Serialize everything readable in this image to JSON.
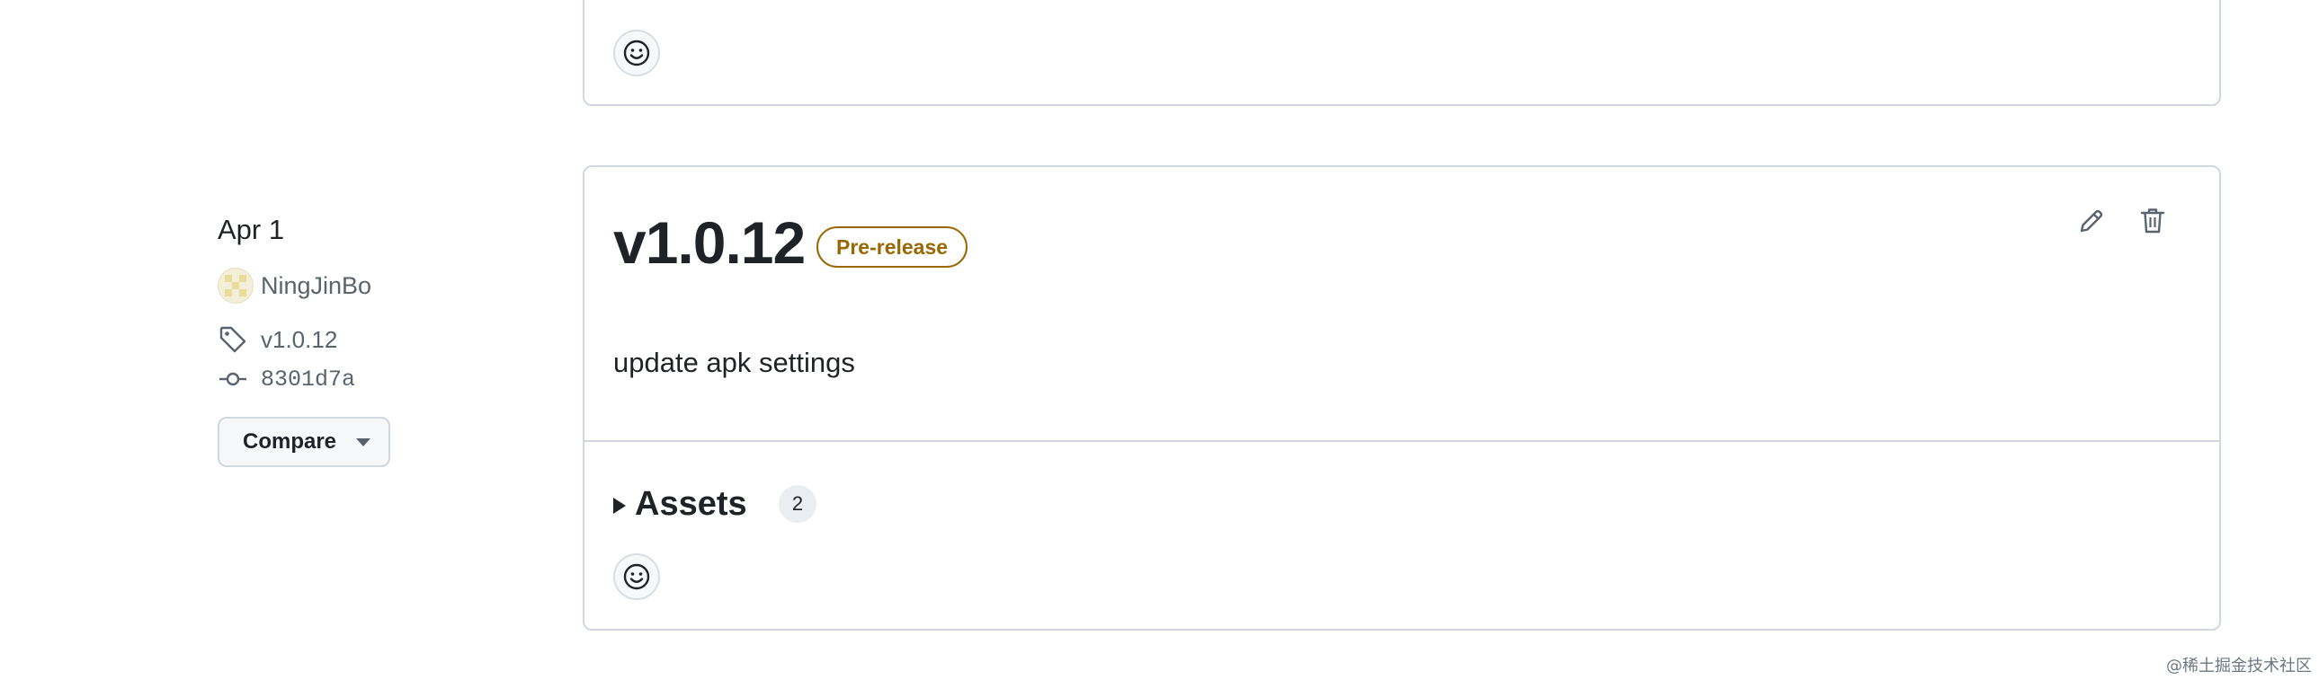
{
  "previous_release": {
    "reaction_icon": "smiley-icon"
  },
  "release": {
    "date": "Apr 1",
    "author": "NingJinBo",
    "tag": "v1.0.12",
    "commit": "8301d7a",
    "compare_label": "Compare",
    "title": "v1.0.12",
    "badge": "Pre-release",
    "note": "update apk settings",
    "assets_label": "Assets",
    "assets_count": "2",
    "icons": {
      "tag": "tag-icon",
      "commit": "git-commit-icon",
      "edit": "pencil-icon",
      "delete": "trash-icon",
      "reaction": "smiley-icon"
    }
  },
  "colors": {
    "prerelease": "#9a6700",
    "border": "#d0d7de",
    "text_muted": "#59636e"
  },
  "watermark": "@稀土掘金技术社区"
}
